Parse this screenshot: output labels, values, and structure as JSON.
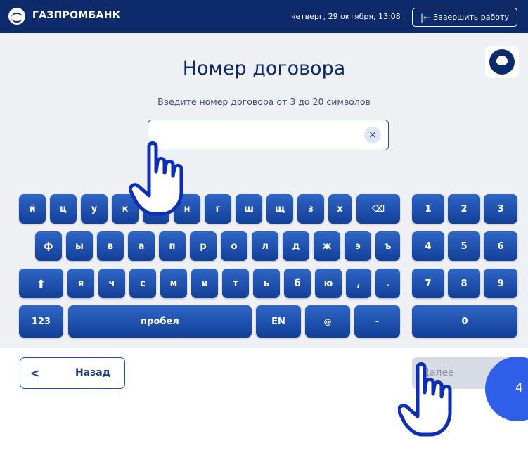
{
  "header": {
    "brand": "ГАЗПРОМБАНК",
    "datetime": "четверг, 29 октября, 13:08",
    "finish_label": "Завершить работу",
    "finish_icon": "exit-arrow-icon",
    "bg_color": "#0d2a6b"
  },
  "page": {
    "title": "Номер договора",
    "subtitle": "Введите номер договора от 3 до 20 символов",
    "input_value": "",
    "clear_symbol": "×"
  },
  "keyboard": {
    "rows": [
      [
        "й",
        "ц",
        "у",
        "к",
        "е",
        "н",
        "г",
        "ш",
        "щ",
        "з",
        "х",
        "⌫"
      ],
      [
        "ф",
        "ы",
        "в",
        "а",
        "п",
        "р",
        "о",
        "л",
        "д",
        "ж",
        "э",
        "ъ"
      ],
      [
        "⬆",
        "я",
        "ч",
        "с",
        "м",
        "и",
        "т",
        "ь",
        "б",
        "ю",
        ",",
        "."
      ],
      [
        "123",
        "пробел",
        "EN",
        "@",
        "-"
      ]
    ],
    "numpad": [
      [
        "1",
        "2",
        "3"
      ],
      [
        "4",
        "5",
        "6"
      ],
      [
        "7",
        "8",
        "9"
      ],
      [
        "0"
      ]
    ]
  },
  "nav": {
    "back_label": "Назад",
    "back_symbol": "<",
    "next_label": "Далее"
  },
  "step": {
    "number": "4",
    "color": "#2f5ee8"
  },
  "colors": {
    "key_top": "#2f66c6",
    "key_bottom": "#123f97",
    "accent": "#1f4fa8"
  }
}
